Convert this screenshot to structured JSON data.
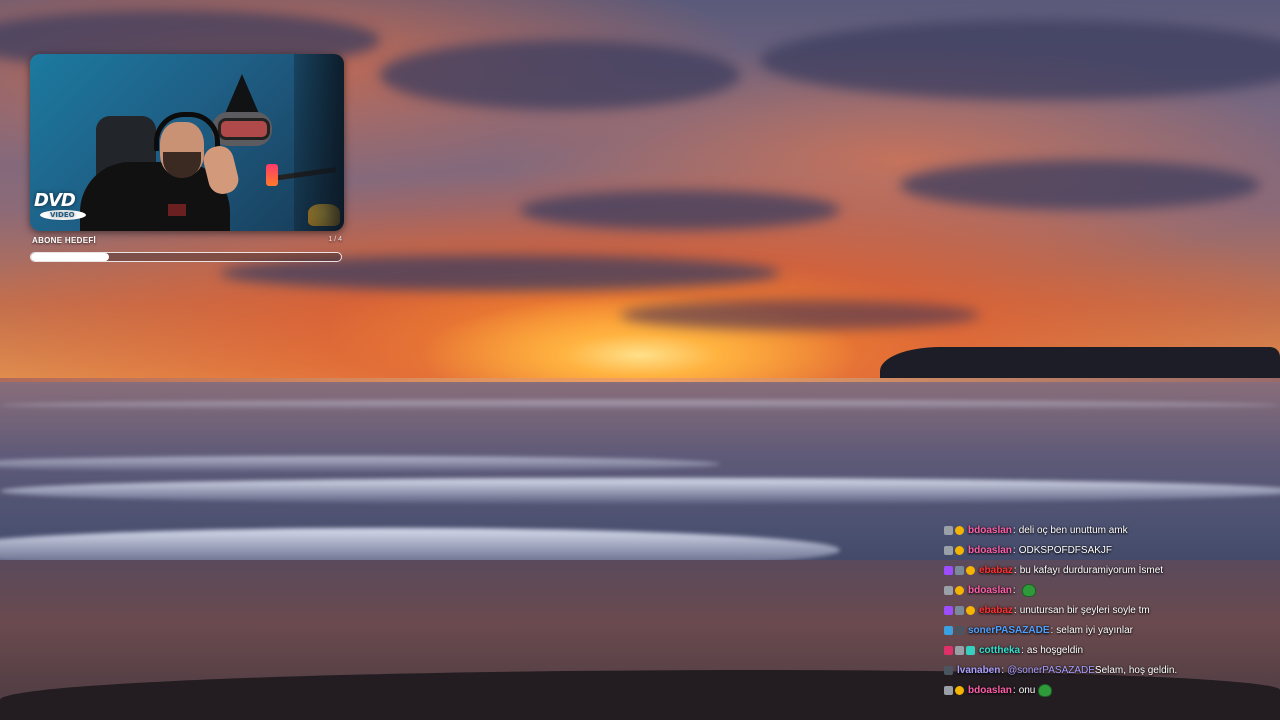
{
  "webcam": {
    "logo_text": "DVD",
    "logo_subtext": "VIDEO"
  },
  "goal": {
    "title": "ABONE HEDEFİ",
    "count": "1 / 4",
    "progress_fraction": 0.25
  },
  "colors": {
    "goal_fill": "#ffffff",
    "coin_badge": "#f5b400"
  },
  "chat": {
    "messages": [
      {
        "user": "bdoaslan",
        "color": "#ff5fa8",
        "badges": [
          "gift-badge-icon",
          "coin-badge-icon"
        ],
        "text": "deli oç ben unuttum amk",
        "mention": "",
        "emote": ""
      },
      {
        "user": "bdoaslan",
        "color": "#ff5fa8",
        "badges": [
          "gift-badge-icon",
          "coin-badge-icon"
        ],
        "text": "ODKSPOFDFSAKJF",
        "mention": "",
        "emote": ""
      },
      {
        "user": "ebabaz",
        "color": "#ff3030",
        "badges": [
          "gem-badge-icon",
          "wrench-badge-icon",
          "coin-badge-icon"
        ],
        "text": "bu kafayı durduramiyorum İsmet",
        "mention": "",
        "emote": ""
      },
      {
        "user": "bdoaslan",
        "color": "#ff5fa8",
        "badges": [
          "gift-badge-icon",
          "coin-badge-icon"
        ],
        "text": "",
        "mention": "",
        "emote": "frog-emote"
      },
      {
        "user": "ebabaz",
        "color": "#ff3030",
        "badges": [
          "gem-badge-icon",
          "wrench-badge-icon",
          "coin-badge-icon"
        ],
        "text": "unutursan bir şeyleri soyle tm",
        "mention": "",
        "emote": ""
      },
      {
        "user": "sonerPASAZADE",
        "color": "#4ea0ff",
        "badges": [
          "cube-badge-icon",
          "sword-badge-icon"
        ],
        "text": "selam iyi yayınlar",
        "mention": "",
        "emote": ""
      },
      {
        "user": "cottheka",
        "color": "#35e0d0",
        "badges": [
          "heart-badge-icon",
          "gift-badge-icon",
          "grid-badge-icon"
        ],
        "text": "as hoşgeldin",
        "mention": "",
        "emote": ""
      },
      {
        "user": "lvanaben",
        "color": "#a8a0ff",
        "badges": [
          "sword-badge-icon"
        ],
        "text": "Selam, hoş geldin.",
        "mention": "@sonerPASAZADE",
        "emote": ""
      },
      {
        "user": "bdoaslan",
        "color": "#ff5fa8",
        "badges": [
          "gift-badge-icon",
          "coin-badge-icon"
        ],
        "text": "onu",
        "mention": "",
        "emote": "frog-emote"
      }
    ]
  }
}
